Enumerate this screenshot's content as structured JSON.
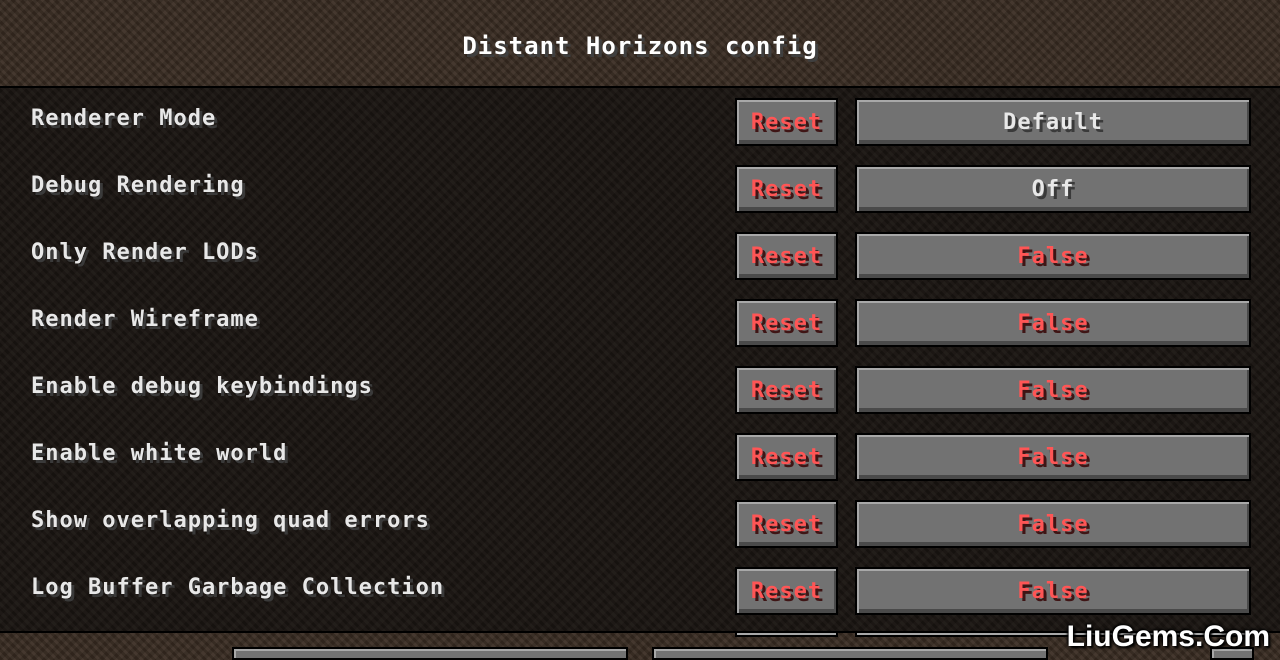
{
  "title": "Distant Horizons config",
  "reset_label": "Reset",
  "rows": [
    {
      "label": "Renderer Mode",
      "value": "Default",
      "value_color": "white"
    },
    {
      "label": "Debug Rendering",
      "value": "Off",
      "value_color": "white"
    },
    {
      "label": "Only Render LODs",
      "value": "False",
      "value_color": "red"
    },
    {
      "label": "Render Wireframe",
      "value": "False",
      "value_color": "red"
    },
    {
      "label": "Enable debug keybindings",
      "value": "False",
      "value_color": "red"
    },
    {
      "label": "Enable white world",
      "value": "False",
      "value_color": "red"
    },
    {
      "label": "Show overlapping quad errors",
      "value": "False",
      "value_color": "red"
    },
    {
      "label": "Log Buffer Garbage Collection",
      "value": "False",
      "value_color": "red"
    }
  ],
  "watermark": "LiuGems.Com",
  "colors": {
    "reset_text": "#ff5555",
    "false_text": "#ff5555",
    "default_text": "#e8e8e8",
    "button_face": "#727272"
  }
}
